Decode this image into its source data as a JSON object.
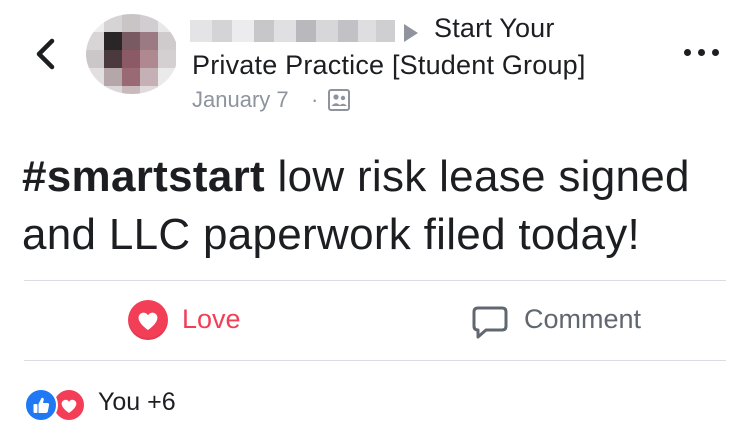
{
  "header": {
    "group_line1": "Start Your",
    "group_line2": "Private Practice [Student Group]",
    "date": "January 7",
    "separator": "·",
    "audience_icon": "group-members-icon"
  },
  "post": {
    "hashtag": "#smartstart",
    "text": " low risk lease signed and LLC paperwork filed today!"
  },
  "actions": {
    "love_label": "Love",
    "comment_label": "Comment"
  },
  "reactions": {
    "summary": "You +6",
    "types": [
      "like",
      "love"
    ]
  },
  "colors": {
    "love": "#f33e58",
    "like": "#2078f4",
    "muted": "#8d949e",
    "text": "#1c1e21"
  }
}
